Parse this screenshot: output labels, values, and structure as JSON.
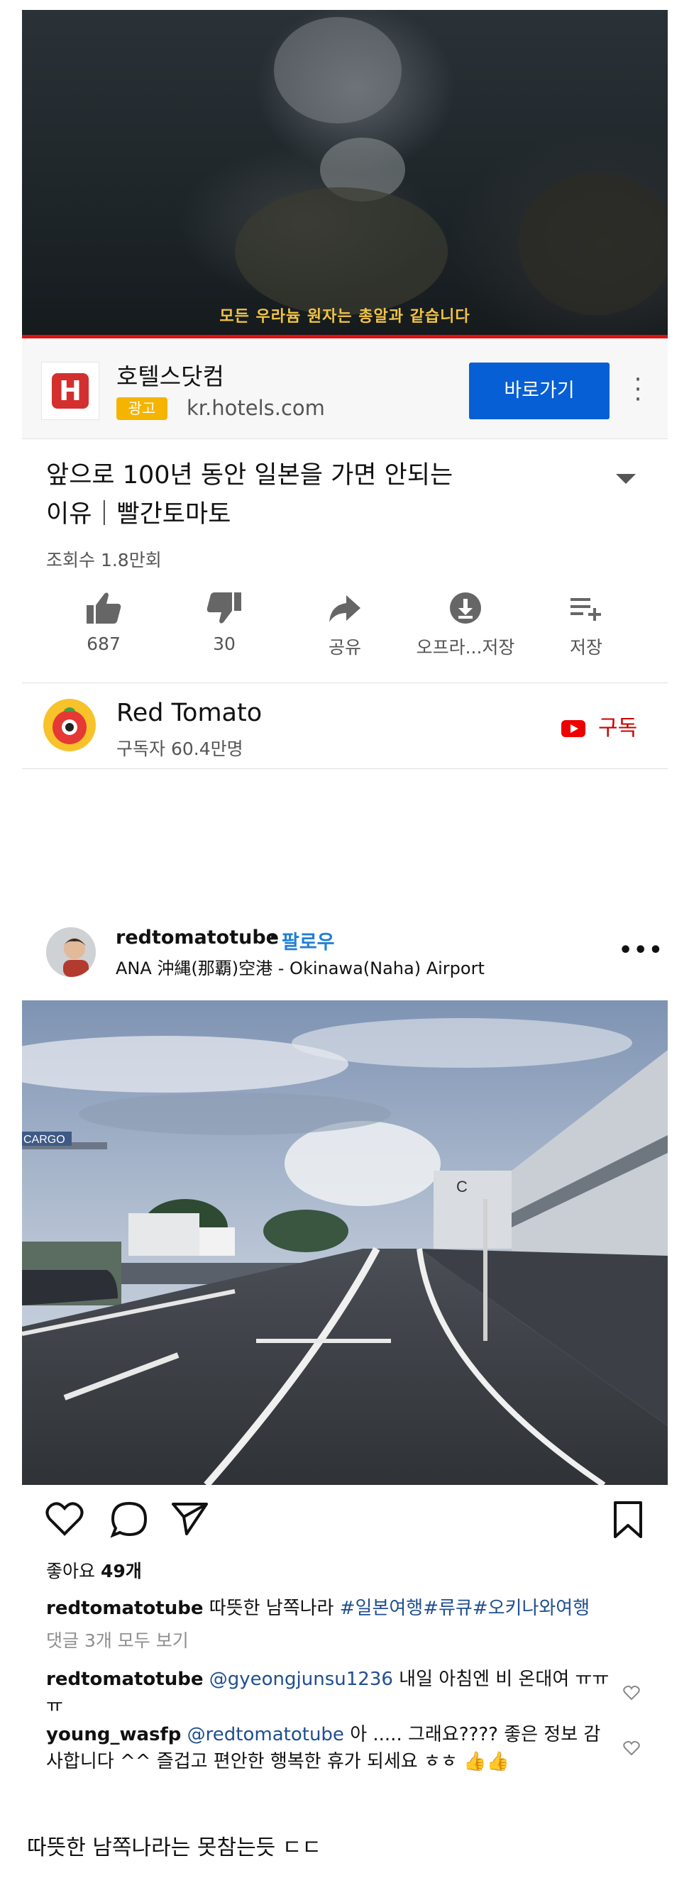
{
  "video": {
    "subtitle": "모든 우라늄 원자는 총알과 같습니다",
    "progress": 1.0
  },
  "ad": {
    "logo_letter": "H",
    "title": "호텔스닷컴",
    "badge": "광고",
    "url": "kr.hotels.com",
    "button_label": "바로가기"
  },
  "video_info": {
    "title_line1": "앞으로 100년 동안 일본을 가면 안되는",
    "title_line2": "이유｜빨간토마토",
    "views": "조회수 1.8만회",
    "actions": [
      {
        "icon": "thumbs-up-icon",
        "label": "687"
      },
      {
        "icon": "thumbs-down-icon",
        "label": "30"
      },
      {
        "icon": "share-icon",
        "label": "공유"
      },
      {
        "icon": "download-icon",
        "label": "오프라...저장"
      },
      {
        "icon": "playlist-add-icon",
        "label": "저장"
      }
    ]
  },
  "channel": {
    "name": "Red Tomato",
    "subscribers": "구독자 60.4만명",
    "subscribe_label": "구독"
  },
  "instagram": {
    "username": "redtomatotube",
    "dot": "•",
    "follow_label": "팔로우",
    "location": "ANA 沖縄(那覇)空港 - Okinawa(Naha) Airport",
    "likes_prefix": "좋아요 ",
    "likes_count": "49개",
    "caption_user": "redtomatotube",
    "caption_text": "따뜻한 남쪽나라 ",
    "caption_tags": "#일본여행#류큐#오키나와여행",
    "view_comments": "댓글 3개 모두 보기",
    "comments": [
      {
        "user": "redtomatotube",
        "mention": "@gyeongjunsu1236",
        "text": " 내일 아침엔 비 온대여 ㅠㅠㅠ"
      },
      {
        "user": "young_wasfp",
        "mention": "@redtomatotube",
        "text": " 아 ..... 그래요???? 좋은 정보 감사합니다 ^^ 즐겁고 편안한 행복한 휴가 되세요 ㅎㅎ 👍👍"
      }
    ],
    "photo_signs": {
      "cargo": "CARGO",
      "building": "C"
    }
  },
  "bottom_note": "따뜻한 남쪽나라는 못참는듯 ㄷㄷ",
  "colors": {
    "youtube_red": "#cc0000",
    "ad_button": "#065fd4",
    "ad_badge": "#f4b400",
    "ig_link": "#1f7fd6"
  }
}
